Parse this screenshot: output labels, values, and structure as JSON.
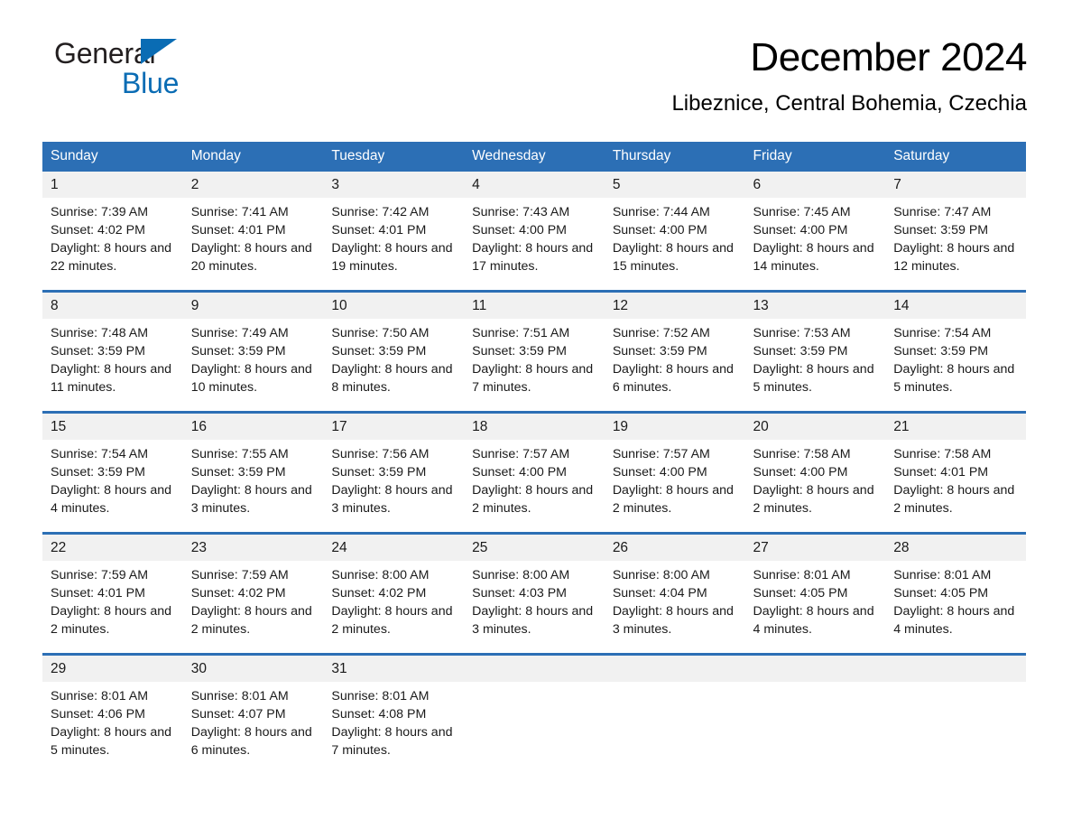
{
  "brand": {
    "name_part1": "General",
    "name_part2": "Blue",
    "triangle_color": "#0a6cb4"
  },
  "header": {
    "title": "December 2024",
    "subtitle": "Libeznice, Central Bohemia, Czechia"
  },
  "theme": {
    "header_blue": "#2c6fb5",
    "daynum_band": "#f1f1f1",
    "text": "#1a1a1a",
    "page_bg": "#ffffff"
  },
  "calendar": {
    "weekday_headers": [
      "Sunday",
      "Monday",
      "Tuesday",
      "Wednesday",
      "Thursday",
      "Friday",
      "Saturday"
    ],
    "weeks": [
      [
        {
          "day": "1",
          "sunrise": "Sunrise: 7:39 AM",
          "sunset": "Sunset: 4:02 PM",
          "daylight": "Daylight: 8 hours and 22 minutes."
        },
        {
          "day": "2",
          "sunrise": "Sunrise: 7:41 AM",
          "sunset": "Sunset: 4:01 PM",
          "daylight": "Daylight: 8 hours and 20 minutes."
        },
        {
          "day": "3",
          "sunrise": "Sunrise: 7:42 AM",
          "sunset": "Sunset: 4:01 PM",
          "daylight": "Daylight: 8 hours and 19 minutes."
        },
        {
          "day": "4",
          "sunrise": "Sunrise: 7:43 AM",
          "sunset": "Sunset: 4:00 PM",
          "daylight": "Daylight: 8 hours and 17 minutes."
        },
        {
          "day": "5",
          "sunrise": "Sunrise: 7:44 AM",
          "sunset": "Sunset: 4:00 PM",
          "daylight": "Daylight: 8 hours and 15 minutes."
        },
        {
          "day": "6",
          "sunrise": "Sunrise: 7:45 AM",
          "sunset": "Sunset: 4:00 PM",
          "daylight": "Daylight: 8 hours and 14 minutes."
        },
        {
          "day": "7",
          "sunrise": "Sunrise: 7:47 AM",
          "sunset": "Sunset: 3:59 PM",
          "daylight": "Daylight: 8 hours and 12 minutes."
        }
      ],
      [
        {
          "day": "8",
          "sunrise": "Sunrise: 7:48 AM",
          "sunset": "Sunset: 3:59 PM",
          "daylight": "Daylight: 8 hours and 11 minutes."
        },
        {
          "day": "9",
          "sunrise": "Sunrise: 7:49 AM",
          "sunset": "Sunset: 3:59 PM",
          "daylight": "Daylight: 8 hours and 10 minutes."
        },
        {
          "day": "10",
          "sunrise": "Sunrise: 7:50 AM",
          "sunset": "Sunset: 3:59 PM",
          "daylight": "Daylight: 8 hours and 8 minutes."
        },
        {
          "day": "11",
          "sunrise": "Sunrise: 7:51 AM",
          "sunset": "Sunset: 3:59 PM",
          "daylight": "Daylight: 8 hours and 7 minutes."
        },
        {
          "day": "12",
          "sunrise": "Sunrise: 7:52 AM",
          "sunset": "Sunset: 3:59 PM",
          "daylight": "Daylight: 8 hours and 6 minutes."
        },
        {
          "day": "13",
          "sunrise": "Sunrise: 7:53 AM",
          "sunset": "Sunset: 3:59 PM",
          "daylight": "Daylight: 8 hours and 5 minutes."
        },
        {
          "day": "14",
          "sunrise": "Sunrise: 7:54 AM",
          "sunset": "Sunset: 3:59 PM",
          "daylight": "Daylight: 8 hours and 5 minutes."
        }
      ],
      [
        {
          "day": "15",
          "sunrise": "Sunrise: 7:54 AM",
          "sunset": "Sunset: 3:59 PM",
          "daylight": "Daylight: 8 hours and 4 minutes."
        },
        {
          "day": "16",
          "sunrise": "Sunrise: 7:55 AM",
          "sunset": "Sunset: 3:59 PM",
          "daylight": "Daylight: 8 hours and 3 minutes."
        },
        {
          "day": "17",
          "sunrise": "Sunrise: 7:56 AM",
          "sunset": "Sunset: 3:59 PM",
          "daylight": "Daylight: 8 hours and 3 minutes."
        },
        {
          "day": "18",
          "sunrise": "Sunrise: 7:57 AM",
          "sunset": "Sunset: 4:00 PM",
          "daylight": "Daylight: 8 hours and 2 minutes."
        },
        {
          "day": "19",
          "sunrise": "Sunrise: 7:57 AM",
          "sunset": "Sunset: 4:00 PM",
          "daylight": "Daylight: 8 hours and 2 minutes."
        },
        {
          "day": "20",
          "sunrise": "Sunrise: 7:58 AM",
          "sunset": "Sunset: 4:00 PM",
          "daylight": "Daylight: 8 hours and 2 minutes."
        },
        {
          "day": "21",
          "sunrise": "Sunrise: 7:58 AM",
          "sunset": "Sunset: 4:01 PM",
          "daylight": "Daylight: 8 hours and 2 minutes."
        }
      ],
      [
        {
          "day": "22",
          "sunrise": "Sunrise: 7:59 AM",
          "sunset": "Sunset: 4:01 PM",
          "daylight": "Daylight: 8 hours and 2 minutes."
        },
        {
          "day": "23",
          "sunrise": "Sunrise: 7:59 AM",
          "sunset": "Sunset: 4:02 PM",
          "daylight": "Daylight: 8 hours and 2 minutes."
        },
        {
          "day": "24",
          "sunrise": "Sunrise: 8:00 AM",
          "sunset": "Sunset: 4:02 PM",
          "daylight": "Daylight: 8 hours and 2 minutes."
        },
        {
          "day": "25",
          "sunrise": "Sunrise: 8:00 AM",
          "sunset": "Sunset: 4:03 PM",
          "daylight": "Daylight: 8 hours and 3 minutes."
        },
        {
          "day": "26",
          "sunrise": "Sunrise: 8:00 AM",
          "sunset": "Sunset: 4:04 PM",
          "daylight": "Daylight: 8 hours and 3 minutes."
        },
        {
          "day": "27",
          "sunrise": "Sunrise: 8:01 AM",
          "sunset": "Sunset: 4:05 PM",
          "daylight": "Daylight: 8 hours and 4 minutes."
        },
        {
          "day": "28",
          "sunrise": "Sunrise: 8:01 AM",
          "sunset": "Sunset: 4:05 PM",
          "daylight": "Daylight: 8 hours and 4 minutes."
        }
      ],
      [
        {
          "day": "29",
          "sunrise": "Sunrise: 8:01 AM",
          "sunset": "Sunset: 4:06 PM",
          "daylight": "Daylight: 8 hours and 5 minutes."
        },
        {
          "day": "30",
          "sunrise": "Sunrise: 8:01 AM",
          "sunset": "Sunset: 4:07 PM",
          "daylight": "Daylight: 8 hours and 6 minutes."
        },
        {
          "day": "31",
          "sunrise": "Sunrise: 8:01 AM",
          "sunset": "Sunset: 4:08 PM",
          "daylight": "Daylight: 8 hours and 7 minutes."
        },
        {
          "day": "",
          "sunrise": "",
          "sunset": "",
          "daylight": ""
        },
        {
          "day": "",
          "sunrise": "",
          "sunset": "",
          "daylight": ""
        },
        {
          "day": "",
          "sunrise": "",
          "sunset": "",
          "daylight": ""
        },
        {
          "day": "",
          "sunrise": "",
          "sunset": "",
          "daylight": ""
        }
      ]
    ]
  }
}
